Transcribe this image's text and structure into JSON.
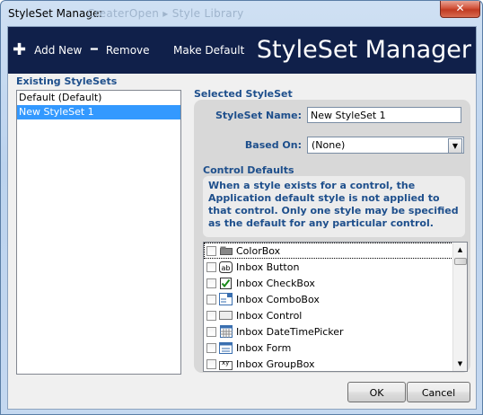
{
  "window": {
    "title": "StyleSet Manager",
    "ghost_title": "CreaterOpen ▸ Style Library",
    "close_glyph": "✕"
  },
  "toolbar": {
    "add_label": "Add New",
    "add_icon": "plus-icon",
    "add_glyph": "✚",
    "remove_label": "Remove",
    "remove_icon": "minus-icon",
    "remove_glyph": "━",
    "make_default_label": "Make Default",
    "header_title": "StyleSet Manager"
  },
  "existing": {
    "label": "Existing StyleSets",
    "items": [
      "Default (Default)",
      "New StyleSet 1"
    ],
    "selected_index": 1
  },
  "selected": {
    "label": "Selected StyleSet",
    "name_label": "StyleSet Name:",
    "name_value": "New StyleSet 1",
    "based_on_label": "Based On:",
    "based_on_value": "(None)",
    "control_defaults_label": "Control Defaults",
    "description": "When a style exists for a control, the Application default style is not applied to that control. Only one style may be specified as the default for any particular control.",
    "controls": [
      {
        "label": "ColorBox",
        "checked": false,
        "icon": "colorbox-icon"
      },
      {
        "label": "Inbox Button",
        "checked": false,
        "icon": "button-icon"
      },
      {
        "label": "Inbox CheckBox",
        "checked": false,
        "icon": "checkbox-icon"
      },
      {
        "label": "Inbox ComboBox",
        "checked": false,
        "icon": "combobox-icon"
      },
      {
        "label": "Inbox Control",
        "checked": false,
        "icon": "control-icon"
      },
      {
        "label": "Inbox DateTimePicker",
        "checked": false,
        "icon": "calendar-icon"
      },
      {
        "label": "Inbox Form",
        "checked": false,
        "icon": "form-icon"
      },
      {
        "label": "Inbox GroupBox",
        "checked": false,
        "icon": "groupbox-icon"
      }
    ]
  },
  "buttons": {
    "ok": "OK",
    "cancel": "Cancel"
  },
  "colors": {
    "header_bg": "#10204a",
    "label_blue": "#1e4f8c",
    "selection": "#3399ff"
  }
}
